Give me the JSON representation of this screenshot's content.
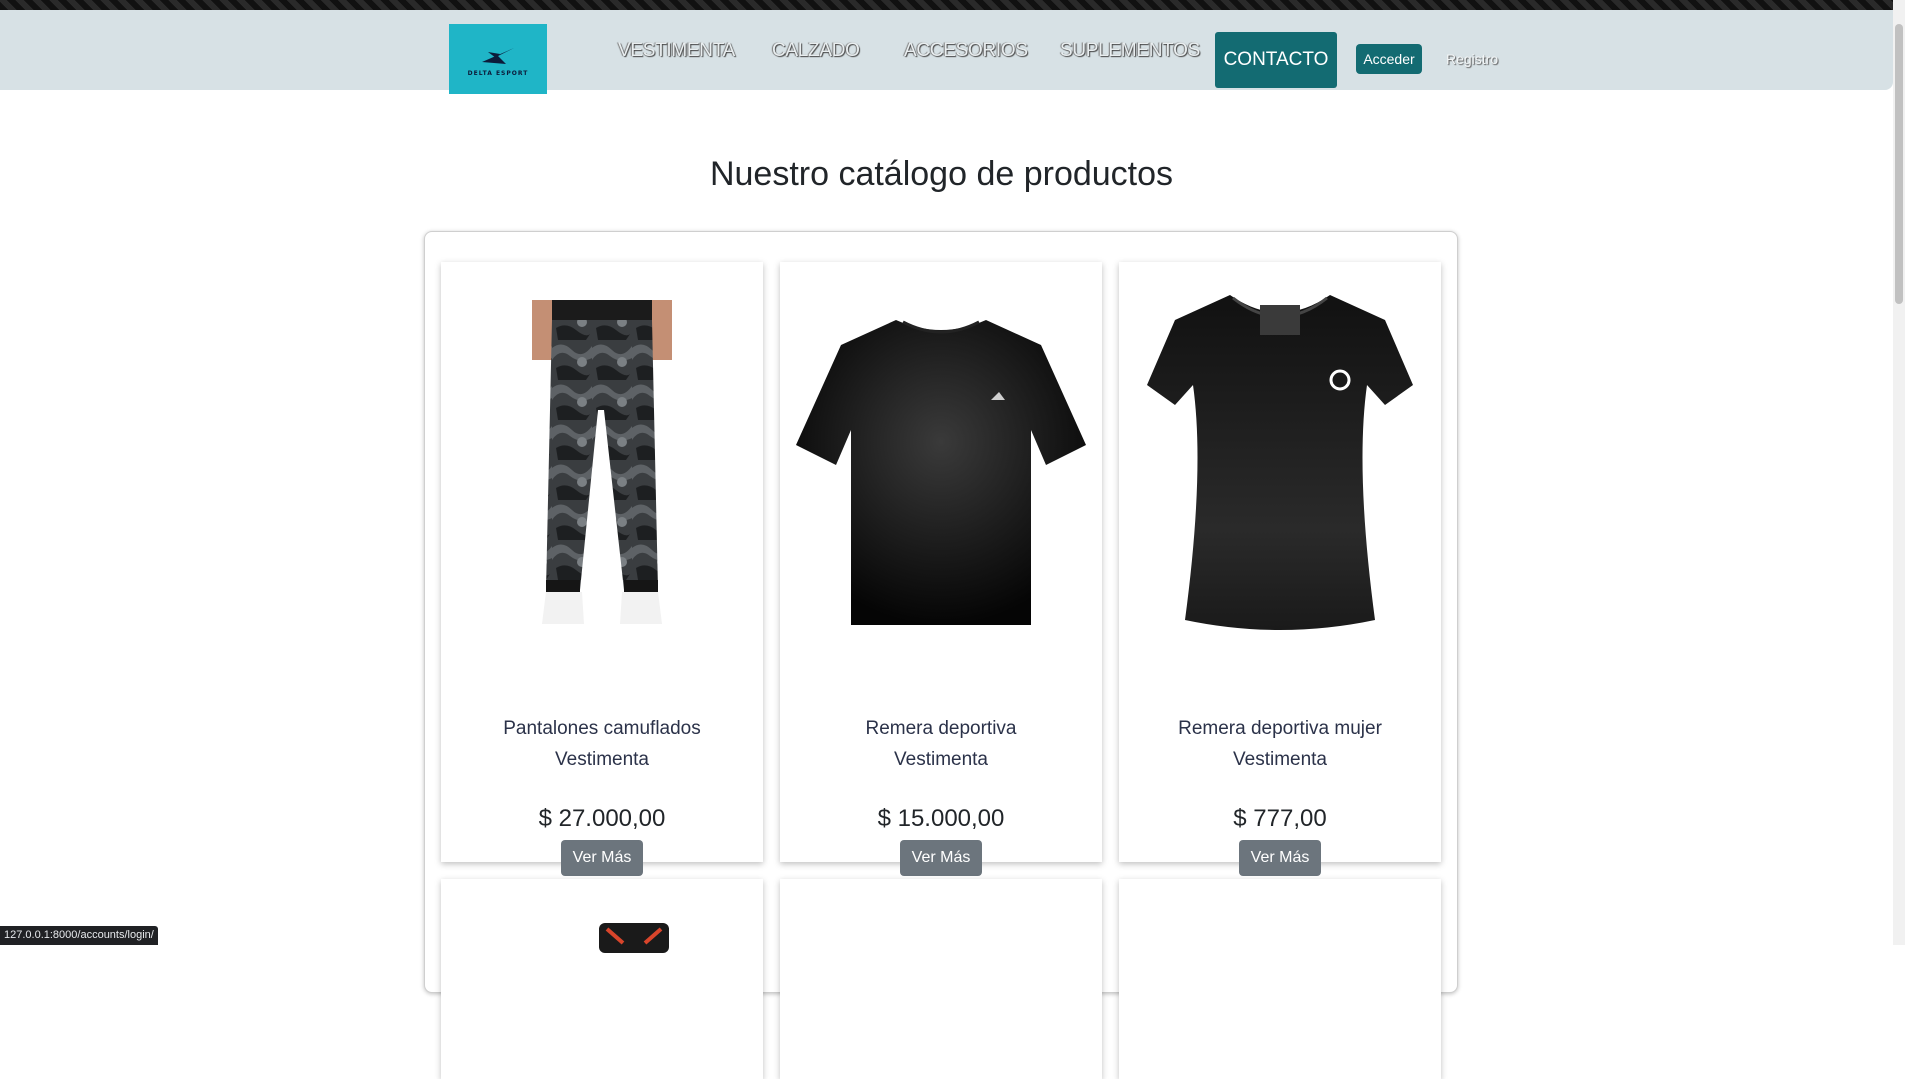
{
  "nav": {
    "logo_text": "DELTA ESPORT",
    "links": [
      "VESTIMENTA",
      "CALZADO",
      "ACCESORIOS",
      "SUPLEMENTOS"
    ],
    "contact_label": "CONTACTO",
    "login_label": "Acceder",
    "register_label": "Registro"
  },
  "page": {
    "title": "Nuestro catálogo de productos"
  },
  "products": [
    {
      "name": "Pantalones camuflados",
      "category": "Vestimenta",
      "price": "$ 27.000,00",
      "button": "Ver Más",
      "image": "camo-pants-icon"
    },
    {
      "name": "Remera deportiva",
      "category": "Vestimenta",
      "price": "$ 15.000,00",
      "button": "Ver Más",
      "image": "black-tshirt-icon"
    },
    {
      "name": "Remera deportiva mujer",
      "category": "Vestimenta",
      "price": "$ 777,00",
      "button": "Ver Más",
      "image": "womens-tshirt-icon"
    }
  ],
  "status_url": "127.0.0.1:8000/accounts/login/",
  "colors": {
    "navbar_bg": "#d7e1e5",
    "logo_bg": "#1fb5c7",
    "primary_btn": "#136b72",
    "secondary_btn": "#6c757d"
  }
}
